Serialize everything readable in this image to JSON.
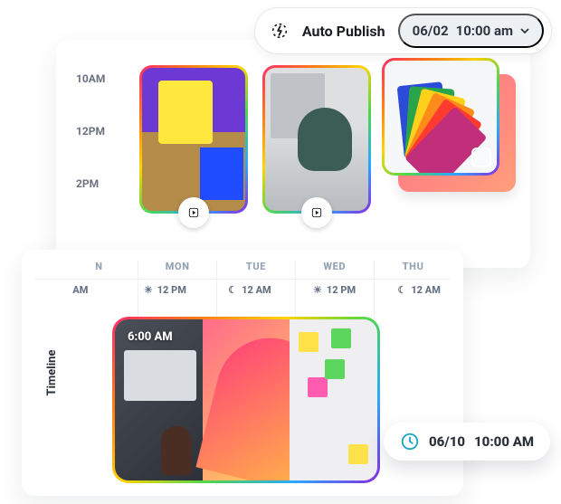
{
  "header": {
    "auto_publish_label": "Auto Publish",
    "date": "06/02",
    "time": "10:00 am",
    "icon": "lightning-refresh-icon",
    "dropdown_icon": "caret-down-icon"
  },
  "upper_card": {
    "time_labels": [
      "10AM",
      "12PM",
      "2PM"
    ],
    "thumbnails": [
      {
        "name": "flatlay-stationery",
        "media_type": "video",
        "media_icon": "play-icon"
      },
      {
        "name": "woman-writing-desk",
        "media_type": "video",
        "media_icon": "play-icon"
      },
      {
        "name": "color-swatch-fan",
        "media_type": "carousel",
        "media_icon": "carousel-icon"
      }
    ]
  },
  "lower_card": {
    "timeline_label": "Timeline",
    "days": [
      {
        "short": "N",
        "label_am": "AM"
      },
      {
        "short": "MON",
        "time": "12 PM",
        "icon": "sun-icon"
      },
      {
        "short": "TUE",
        "time": "12 AM",
        "icon": "moon-icon"
      },
      {
        "short": "WED",
        "time": "12 PM",
        "icon": "sun-icon"
      },
      {
        "short": "THU",
        "time": "12 AM",
        "icon": "moon-icon"
      }
    ],
    "wide_post": {
      "overlay_time": "6:00 AM",
      "panes": [
        "laptop-phone-hand",
        "orange-paper-curl",
        "sticky-note-planning"
      ]
    }
  },
  "schedule_popover": {
    "icon": "clock-icon",
    "date": "06/10",
    "time": "10:00 AM"
  }
}
